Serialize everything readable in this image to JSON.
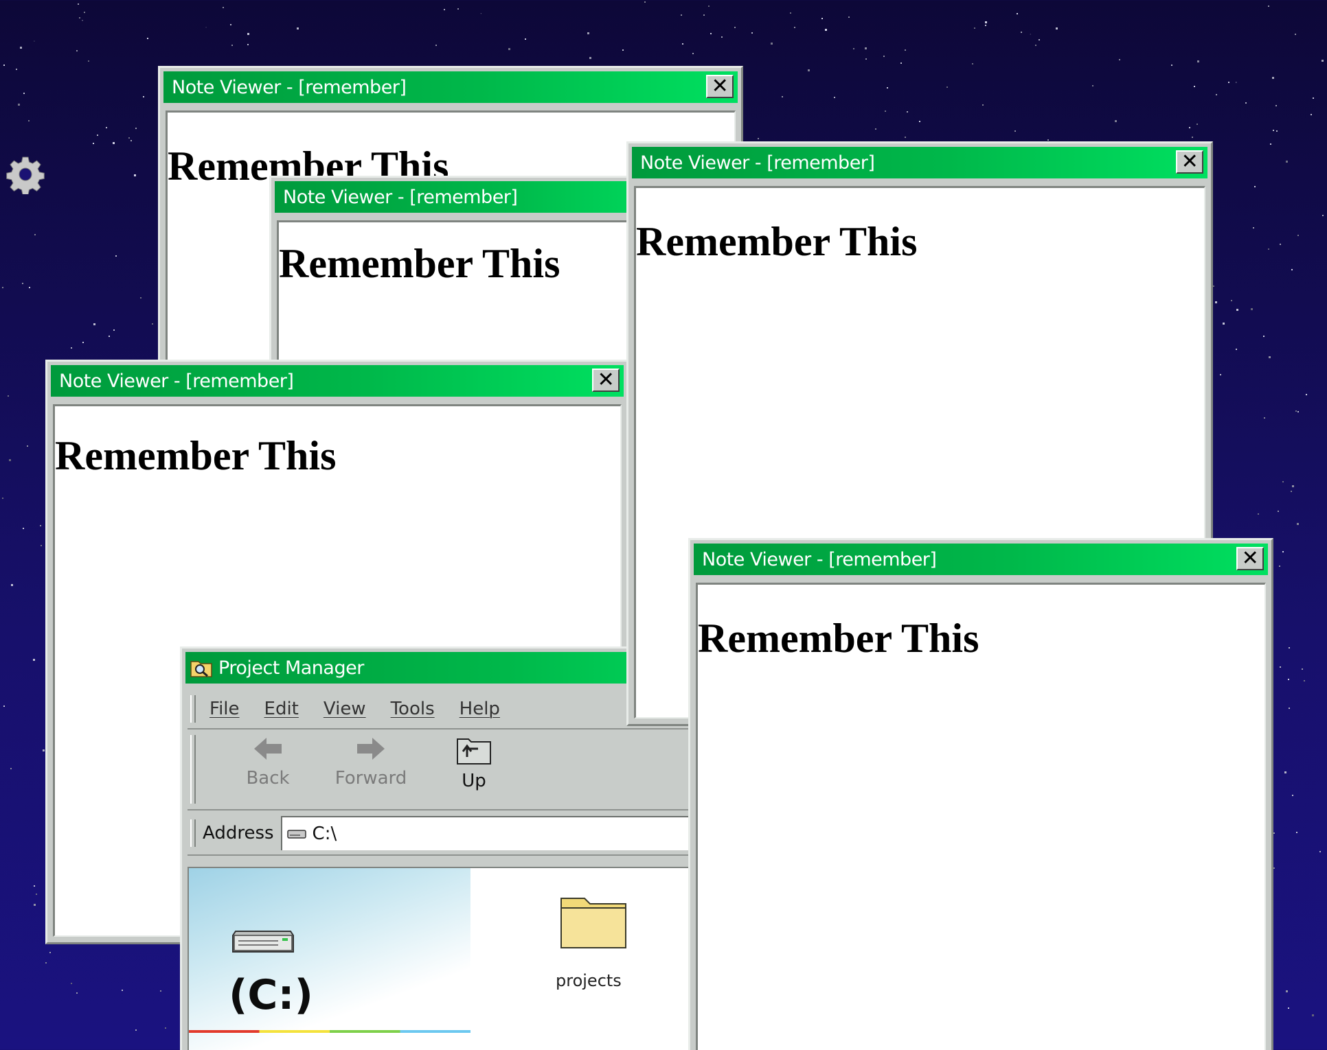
{
  "desktop": {
    "settings_icon": "gear-icon",
    "background_color": "#130c5a"
  },
  "note_windows": [
    {
      "title": "Note Viewer - [remember]",
      "content": "Remember This",
      "close": "✕"
    },
    {
      "title": "Note Viewer - [remember]",
      "content": "Remember This",
      "close": "✕"
    },
    {
      "title": "Note Viewer - [remember]",
      "content": "Remember This",
      "close": "✕"
    },
    {
      "title": "Note Viewer - [remember]",
      "content": "Remember This",
      "close": "✕"
    },
    {
      "title": "Note Viewer - [remember]",
      "content": "Remember This",
      "close": "✕"
    }
  ],
  "project_manager": {
    "title": "Project Manager",
    "menu": [
      "File",
      "Edit",
      "View",
      "Tools",
      "Help"
    ],
    "toolbar": {
      "back": "Back",
      "forward": "Forward",
      "up": "Up"
    },
    "address_label": "Address",
    "address_value": "C:\\",
    "drive_label": "(C:)",
    "folder_name": "projects"
  },
  "colors": {
    "titlebar_start": "#009a3c",
    "titlebar_end": "#00e060",
    "window_face": "#c8ccc9"
  }
}
